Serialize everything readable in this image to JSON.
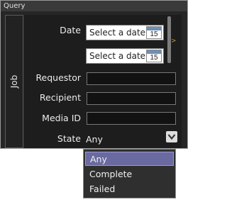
{
  "window": {
    "title": "Query"
  },
  "side_tab": {
    "label": "Job"
  },
  "form": {
    "date_label": "Date",
    "date_from_placeholder": "Select a date",
    "date_to_placeholder": "Select a date",
    "calendar_day": "15",
    "requestor_label": "Requestor",
    "recipient_label": "Recipient",
    "media_id_label": "Media ID",
    "state_label": "State",
    "state_value": "Any"
  },
  "state_dropdown": {
    "options": [
      "Any",
      "Complete",
      "Failed"
    ],
    "selected": "Any"
  },
  "icons": {
    "calendar": "calendar-icon",
    "dropdown": "chevron-down-icon",
    "expand": "chevron-right-icon"
  },
  "colors": {
    "panel_bg": "#262626",
    "highlight": "#6a6aa0",
    "expand_arrow": "#c99a2a"
  }
}
